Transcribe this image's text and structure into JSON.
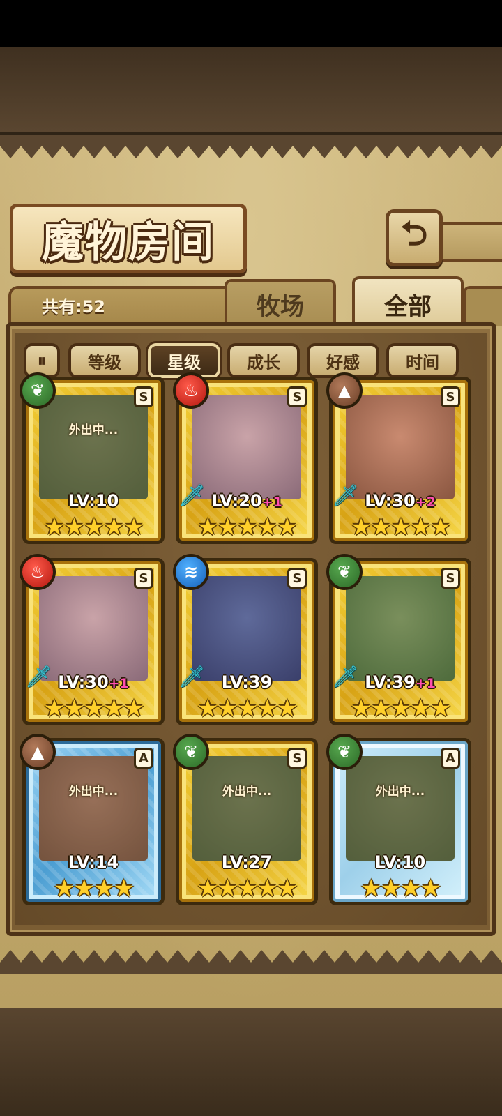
{
  "header": {
    "title": "魔物房间",
    "back_icon": "back-arrow-icon"
  },
  "summary": {
    "count_label": "共有:52"
  },
  "tabs": [
    {
      "label": "牧场",
      "active": false
    },
    {
      "label": "全部",
      "active": true
    }
  ],
  "sort": {
    "toggle_icon": "sort-toggle-icon",
    "buttons": [
      {
        "label": "等级",
        "active": false
      },
      {
        "label": "星级",
        "active": true
      },
      {
        "label": "成长",
        "active": false
      },
      {
        "label": "好感",
        "active": false
      },
      {
        "label": "时间",
        "active": false
      }
    ]
  },
  "colors": {
    "gold_frame": "#e1b21f",
    "blue_frame": "#4c9ed2",
    "active_sort": "#4a3219",
    "plus_text": "#ff4fb0"
  },
  "monsters": [
    {
      "element": "nature",
      "rank": "S",
      "level": "LV:10",
      "bonus": "",
      "stars": 5,
      "status": "外出中...",
      "frame": "gold",
      "weapon": false
    },
    {
      "element": "fire",
      "rank": "S",
      "level": "LV:20",
      "bonus": "+1",
      "stars": 5,
      "status": "",
      "frame": "gold",
      "weapon": true
    },
    {
      "element": "earth",
      "rank": "S",
      "level": "LV:30",
      "bonus": "+2",
      "stars": 5,
      "status": "",
      "frame": "gold",
      "weapon": true
    },
    {
      "element": "fire",
      "rank": "S",
      "level": "LV:30",
      "bonus": "+1",
      "stars": 5,
      "status": "",
      "frame": "gold",
      "weapon": true
    },
    {
      "element": "water",
      "rank": "S",
      "level": "LV:39",
      "bonus": "",
      "stars": 5,
      "status": "",
      "frame": "gold",
      "weapon": true
    },
    {
      "element": "nature",
      "rank": "S",
      "level": "LV:39",
      "bonus": "+1",
      "stars": 5,
      "status": "",
      "frame": "gold",
      "weapon": true
    },
    {
      "element": "earth",
      "rank": "A",
      "level": "LV:14",
      "bonus": "",
      "stars": 4,
      "status": "外出中...",
      "frame": "blue",
      "weapon": false
    },
    {
      "element": "nature",
      "rank": "S",
      "level": "LV:27",
      "bonus": "",
      "stars": 5,
      "status": "外出中...",
      "frame": "gold",
      "weapon": false
    },
    {
      "element": "nature",
      "rank": "A",
      "level": "LV:10",
      "bonus": "",
      "stars": 4,
      "status": "外出中...",
      "frame": "bluelight",
      "weapon": false
    }
  ]
}
